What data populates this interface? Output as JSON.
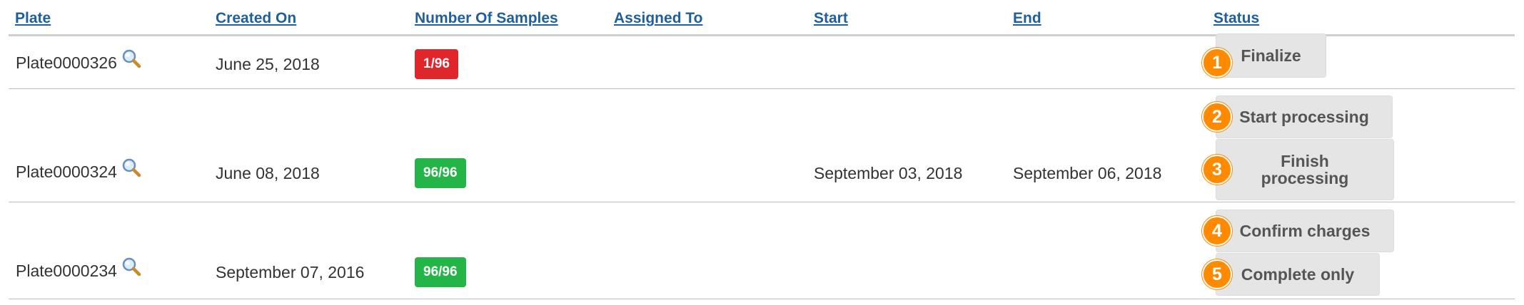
{
  "headers": {
    "plate": "Plate",
    "created_on": "Created On",
    "number_of_samples": "Number Of Samples",
    "assigned_to": "Assigned To",
    "start": "Start",
    "end": "End",
    "status": "Status"
  },
  "rows": [
    {
      "plate": "Plate0000326",
      "created_on": "June 25, 2018",
      "samples": "1/96",
      "samples_color": "#e0262b",
      "assigned_to": "",
      "start": "",
      "end": "",
      "actions": [
        {
          "marker": "1",
          "label": "Finalize"
        }
      ]
    },
    {
      "plate": "Plate0000324",
      "created_on": "June 08, 2018",
      "samples": "96/96",
      "samples_color": "#24b548",
      "assigned_to": "",
      "start": "September 03, 2018",
      "end": "September 06, 2018",
      "actions": [
        {
          "marker": "2",
          "label": "Start processing"
        },
        {
          "marker": "3",
          "label_line1": "Finish",
          "label_line2": "processing"
        }
      ]
    },
    {
      "plate": "Plate0000234",
      "created_on": "September 07, 2016",
      "samples": "96/96",
      "samples_color": "#24b548",
      "assigned_to": "",
      "start": "",
      "end": "",
      "actions": [
        {
          "marker": "4",
          "label": "Confirm charges"
        },
        {
          "marker": "5",
          "label": "Complete only"
        }
      ]
    }
  ],
  "icons": {
    "plate_lookup": "magnifier-icon",
    "marker_color": "#ff8a00"
  }
}
